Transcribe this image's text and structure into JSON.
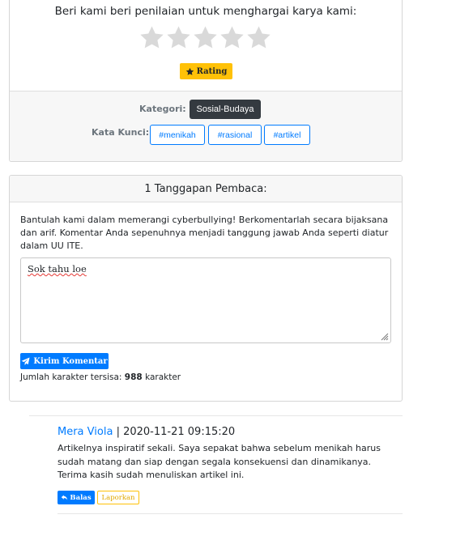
{
  "rating": {
    "prompt": "Beri kami beri penilaian untuk menghargai karya kami:",
    "star_count": 5,
    "button_label": "Rating",
    "colors": {
      "star": "#d9d9d9",
      "button": "#ffc107"
    }
  },
  "meta": {
    "category_label": "Kategori:",
    "category_value": "Sosial-Budaya",
    "keywords_label": "Kata Kunci:",
    "tags": [
      "#menikah",
      "#rasional",
      "#artikel"
    ]
  },
  "comments": {
    "header": "1 Tanggapan Pembaca:",
    "notice": "Bantulah kami dalam memerangi cyberbullying! Berkomentarlah secara bijaksana dan arif. Komentar Anda sepenuhnya menjadi tanggung jawab Anda seperti diatur dalam UU ITE.",
    "textarea_value": "Sok tahu loe",
    "submit_label": "Kirim Komentar",
    "remaining_prefix": "Jumlah karakter tersisa:",
    "remaining_count": "988",
    "remaining_suffix": "karakter"
  },
  "reply": {
    "author": "Mera Viola",
    "separator": "|",
    "datetime": "2020-11-21 09:15:20",
    "text": "Artikelnya inspiratif sekali. Saya sepakat bahwa sebelum menikah harus sudah matang dan siap dengan segala konsekuensi dan dinamikanya. Terima kasih sudah menuliskan artikel ini.",
    "reply_label": "Balas",
    "report_label": "Laporkan"
  }
}
